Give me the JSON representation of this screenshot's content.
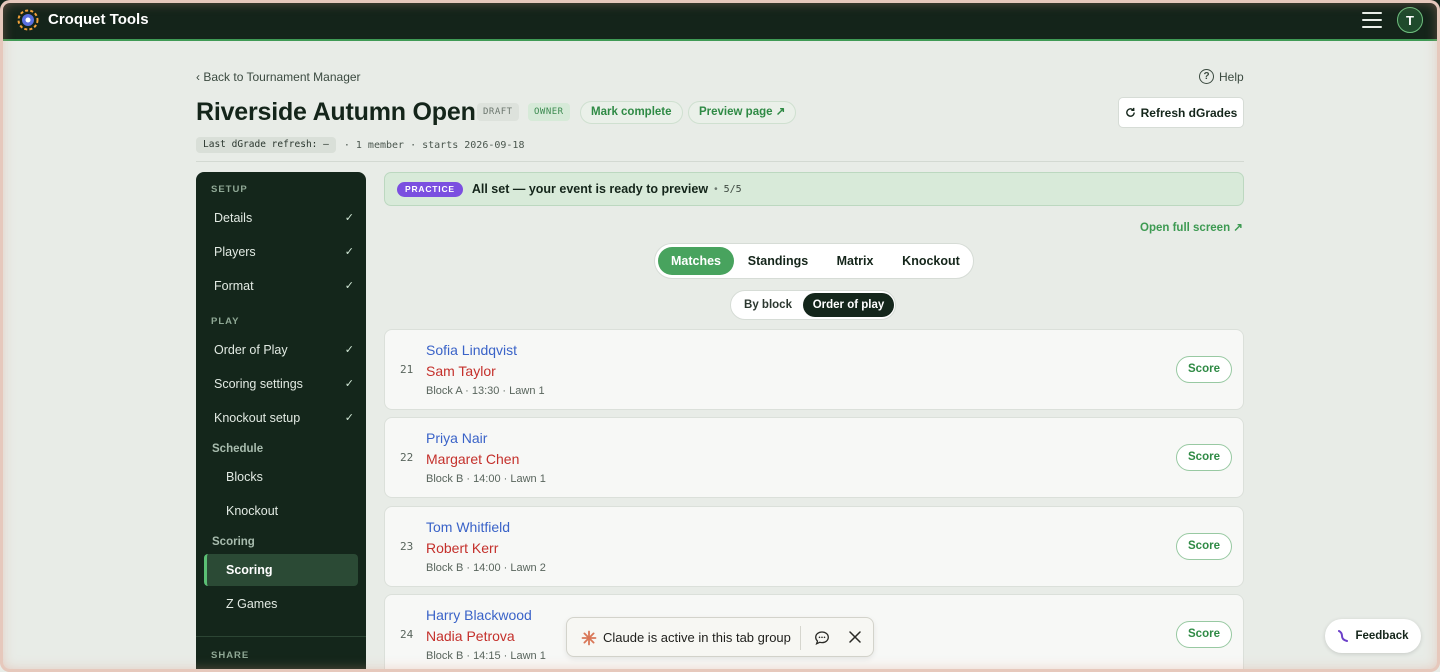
{
  "app": {
    "title": "Croquet Tools",
    "avatar_initial": "T"
  },
  "header": {
    "back_label": "Back to Tournament Manager",
    "help_label": "Help",
    "title": "Riverside Autumn Open",
    "badge_draft": "DRAFT",
    "badge_owner": "OWNER",
    "mark_complete": "Mark complete",
    "preview_page": "Preview page ↗",
    "refresh_label": "Refresh dGrades",
    "last_refresh": "Last dGrade refresh: —",
    "meta": "· 1 member · starts 2026-09-18"
  },
  "sidebar": {
    "setup_heading": "SETUP",
    "setup_items": [
      {
        "label": "Details",
        "check": "✓"
      },
      {
        "label": "Players",
        "check": "✓"
      },
      {
        "label": "Format",
        "check": "✓"
      }
    ],
    "play_heading": "PLAY",
    "play_items": [
      {
        "label": "Order of Play",
        "check": "✓"
      },
      {
        "label": "Scoring settings",
        "check": "✓"
      },
      {
        "label": "Knockout setup",
        "check": "✓"
      }
    ],
    "schedule_heading": "Schedule",
    "schedule_items": [
      "Blocks",
      "Knockout"
    ],
    "scoring_heading": "Scoring",
    "scoring_items": [
      "Scoring",
      "Z Games"
    ],
    "share_heading": "SHARE"
  },
  "banner": {
    "tag": "PRACTICE",
    "text": "All set — your event is ready to preview",
    "dot": "•",
    "count": "5/5"
  },
  "open_full_screen": "Open full screen ↗",
  "tabs": [
    "Matches",
    "Standings",
    "Matrix",
    "Knockout"
  ],
  "subtabs": [
    "By block",
    "Order of play"
  ],
  "matches": [
    {
      "num": "21",
      "player1": "Sofia Lindqvist",
      "player2": "Sam Taylor",
      "info": "Block A · 13:30 · Lawn 1",
      "action": "Score"
    },
    {
      "num": "22",
      "player1": "Priya Nair",
      "player2": "Margaret Chen",
      "info": "Block B · 14:00 · Lawn 1",
      "action": "Score"
    },
    {
      "num": "23",
      "player1": "Tom Whitfield",
      "player2": "Robert Kerr",
      "info": "Block B · 14:00 · Lawn 2",
      "action": "Score"
    },
    {
      "num": "24",
      "player1": "Harry Blackwood",
      "player2": "Nadia Petrova",
      "info": "Block B · 14:15 · Lawn 1",
      "action": "Score"
    }
  ],
  "toast": {
    "text": "Claude is active in this tab group"
  },
  "feedback": {
    "label": "Feedback"
  },
  "colors": {
    "accent": "#48a35e",
    "sidebar": "#14261b",
    "player1": "#3a63c8",
    "player2": "#c4302b",
    "practice": "#7b4fe0"
  }
}
